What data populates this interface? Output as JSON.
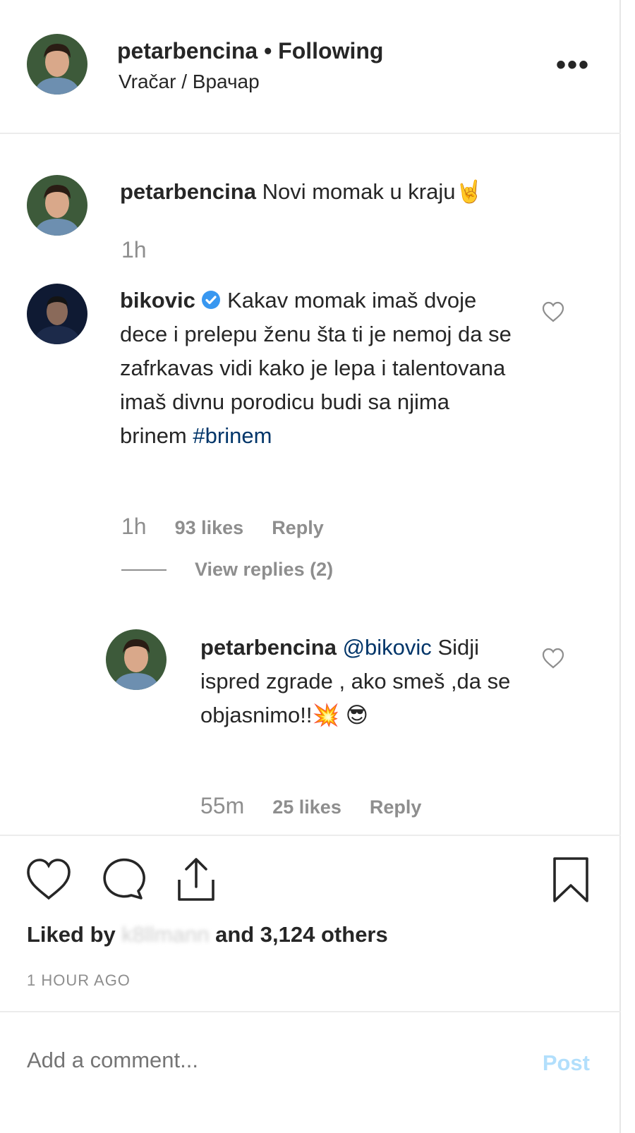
{
  "header": {
    "username": "petarbencina",
    "separator": " • ",
    "follow_status": "Following",
    "location": "Vračar / Врачар",
    "more_label": "•••"
  },
  "caption": {
    "username": "petarbencina",
    "text": "Novi momak u kraju",
    "emoji": "🤘",
    "time": "1h"
  },
  "comment1": {
    "username": "bikovic",
    "verified": true,
    "text": "Kakav momak imaš dvoje dece i prelepu ženu šta ti je nemoj da se zafrkavas vidi kako je lepa i talentovana imaš divnu porodicu budi sa njima brinem",
    "hashtag": "#brinem",
    "time": "1h",
    "likes": "93 likes",
    "reply": "Reply",
    "view_replies": "View replies (2)"
  },
  "reply1": {
    "username": "petarbencina",
    "mention": "@bikovic",
    "text": "Sidji ispred zgrade , ako smeš ,da se objasnimo!!",
    "emoji1": "💥",
    "emoji2": "😎",
    "time": "55m",
    "likes": "25 likes",
    "reply": "Reply"
  },
  "actions": {
    "liked_by_prefix": "Liked by",
    "liked_by_user": "k8llmann",
    "liked_by_suffix": "and 3,124 others",
    "timestamp": "1 HOUR AGO"
  },
  "add_comment": {
    "placeholder": "Add a comment...",
    "post_label": "Post"
  },
  "colors": {
    "text": "#262626",
    "secondary": "#8e8e8e",
    "link": "#003569",
    "post_disabled": "#b2dffc",
    "verified": "#3897f0"
  }
}
